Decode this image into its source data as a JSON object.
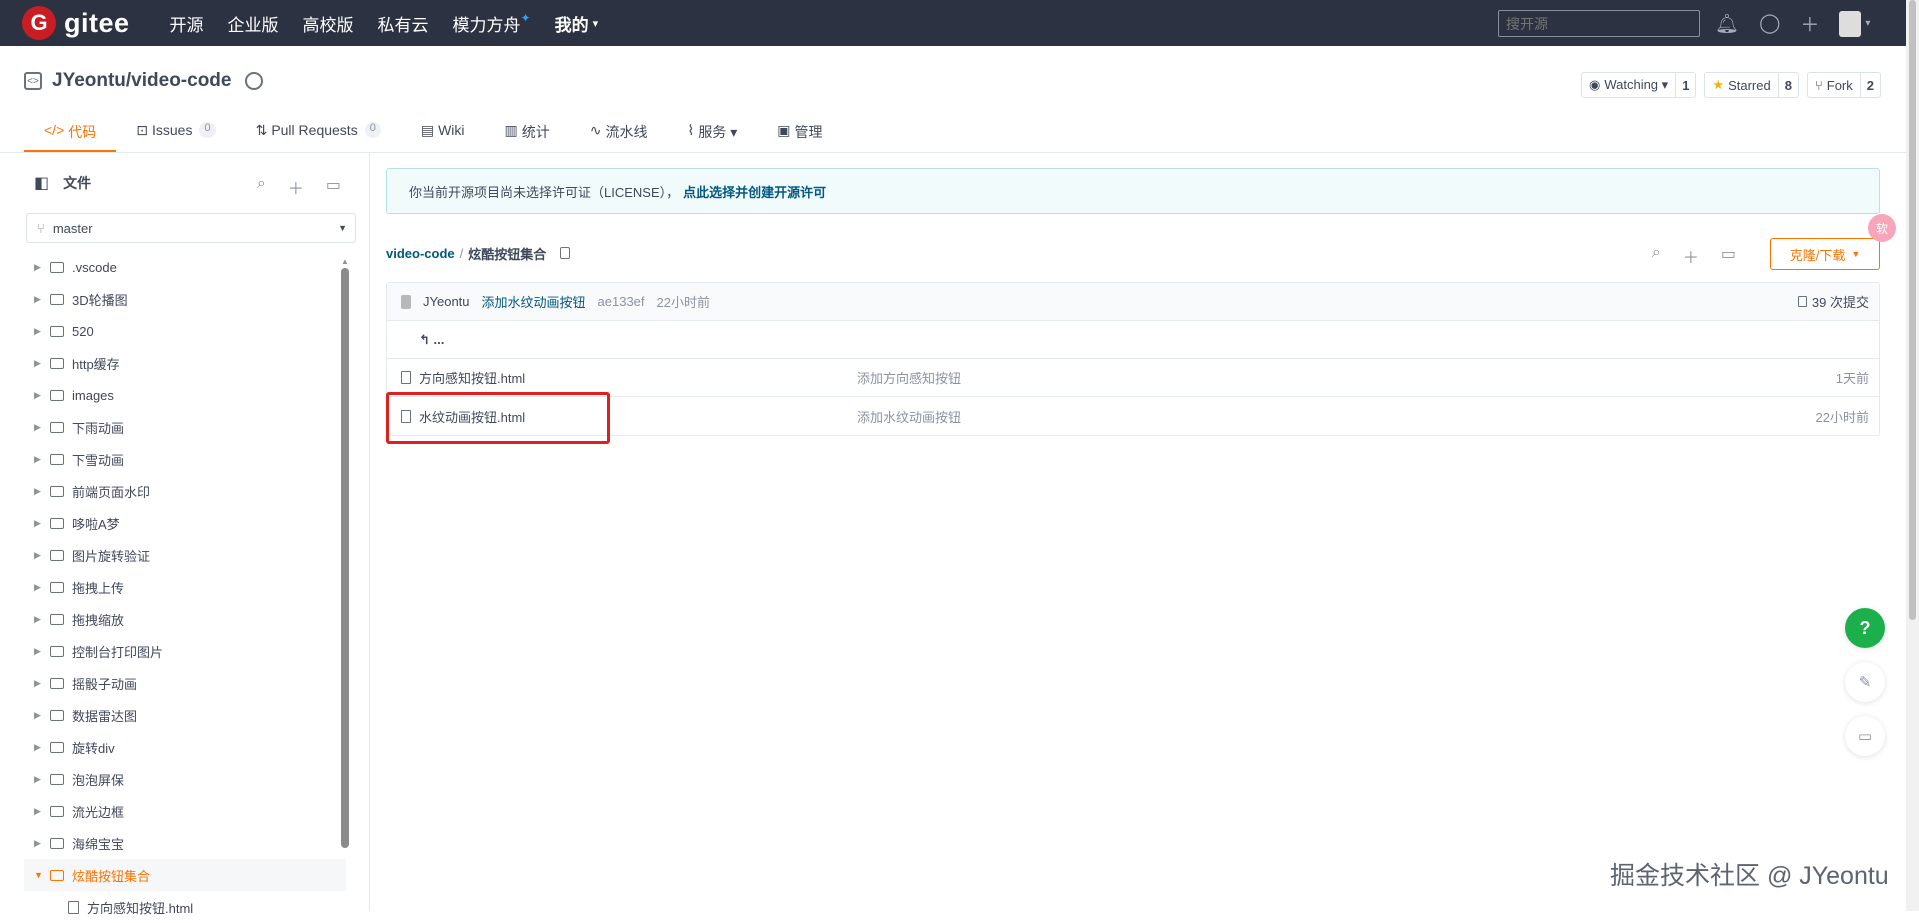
{
  "topnav": {
    "logo_letter": "G",
    "logo_text": "gitee",
    "items": [
      {
        "label": "开源"
      },
      {
        "label": "企业版"
      },
      {
        "label": "高校版"
      },
      {
        "label": "私有云"
      },
      {
        "label": "模力方舟",
        "star": "✦"
      },
      {
        "label": "我的",
        "caret": "▾"
      }
    ],
    "search_placeholder": "搜开源",
    "icons": [
      "bell-icon",
      "bulb-icon",
      "plus-icon",
      "avatar"
    ]
  },
  "repo": {
    "title": "JYeontu/video-code",
    "actions": [
      {
        "label": "Watching ▾",
        "count": "1"
      },
      {
        "label": "Starred",
        "count": "8"
      },
      {
        "label": "Fork",
        "count": "2"
      }
    ]
  },
  "tabs": [
    {
      "label": "代码",
      "icon": "</>",
      "active": true
    },
    {
      "label": "Issues",
      "count": "0"
    },
    {
      "label": "Pull Requests",
      "count": "0"
    },
    {
      "label": "Wiki"
    },
    {
      "label": "统计"
    },
    {
      "label": "流水线"
    },
    {
      "label": "服务 ▾"
    },
    {
      "label": "管理"
    }
  ],
  "sidebar": {
    "title": "文件",
    "branch": "master",
    "tree": [
      {
        "label": ".vscode"
      },
      {
        "label": "3D轮播图"
      },
      {
        "label": "520"
      },
      {
        "label": "http缓存"
      },
      {
        "label": "images"
      },
      {
        "label": "下雨动画"
      },
      {
        "label": "下雪动画"
      },
      {
        "label": "前端页面水印"
      },
      {
        "label": "哆啦A梦"
      },
      {
        "label": "图片旋转验证"
      },
      {
        "label": "拖拽上传"
      },
      {
        "label": "拖拽缩放"
      },
      {
        "label": "控制台打印图片"
      },
      {
        "label": "摇骰子动画"
      },
      {
        "label": "数据雷达图"
      },
      {
        "label": "旋转div"
      },
      {
        "label": "泡泡屏保"
      },
      {
        "label": "流光边框"
      },
      {
        "label": "海绵宝宝"
      },
      {
        "label": "炫酷按钮集合",
        "active": true
      },
      {
        "label": "方向感知按钮.html",
        "child": true
      }
    ]
  },
  "main": {
    "license_text": "你当前开源项目尚未选择许可证（LICENSE），",
    "license_link": "点此选择并创建开源许可",
    "path_root": "video-code",
    "path_sep": "/",
    "path_current": "炫酷按钮集合",
    "clone_label": "克隆/下载",
    "commit": {
      "author": "JYeontu",
      "message": "添加水纹动画按钮",
      "hash": "ae133ef",
      "time": "22小时前",
      "count": "39 次提交"
    },
    "back_label": "↰ ...",
    "files": [
      {
        "name": "方向感知按钮.html",
        "message": "添加方向感知按钮",
        "time": "1天前"
      },
      {
        "name": "水纹动画按钮.html",
        "message": "添加水纹动画按钮",
        "time": "22小时前"
      }
    ]
  },
  "floating": {
    "help": "?",
    "pink_badge": "软"
  },
  "watermark": "掘金技术社区 @ JYeontu",
  "colors": {
    "accent": "#fe7300",
    "link": "#005980",
    "nav_bg": "#2c3241",
    "highlight": "#e02020",
    "help_green": "#1cb04c"
  }
}
